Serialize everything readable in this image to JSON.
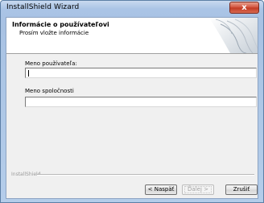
{
  "window": {
    "title": "InstallShield Wizard",
    "close_label": "x"
  },
  "header": {
    "title": "Informácie o používateľovi",
    "subtitle": "Prosím vložte informácie"
  },
  "form": {
    "username_label": "Meno používateľa:",
    "username_value": "",
    "company_label": "Meno spoločnosti",
    "company_value": ""
  },
  "footer": {
    "brand": "InstallShield",
    "back_label": "< Naspäť",
    "next_label": "Ďalej >",
    "cancel_label": "Zrušiť"
  }
}
